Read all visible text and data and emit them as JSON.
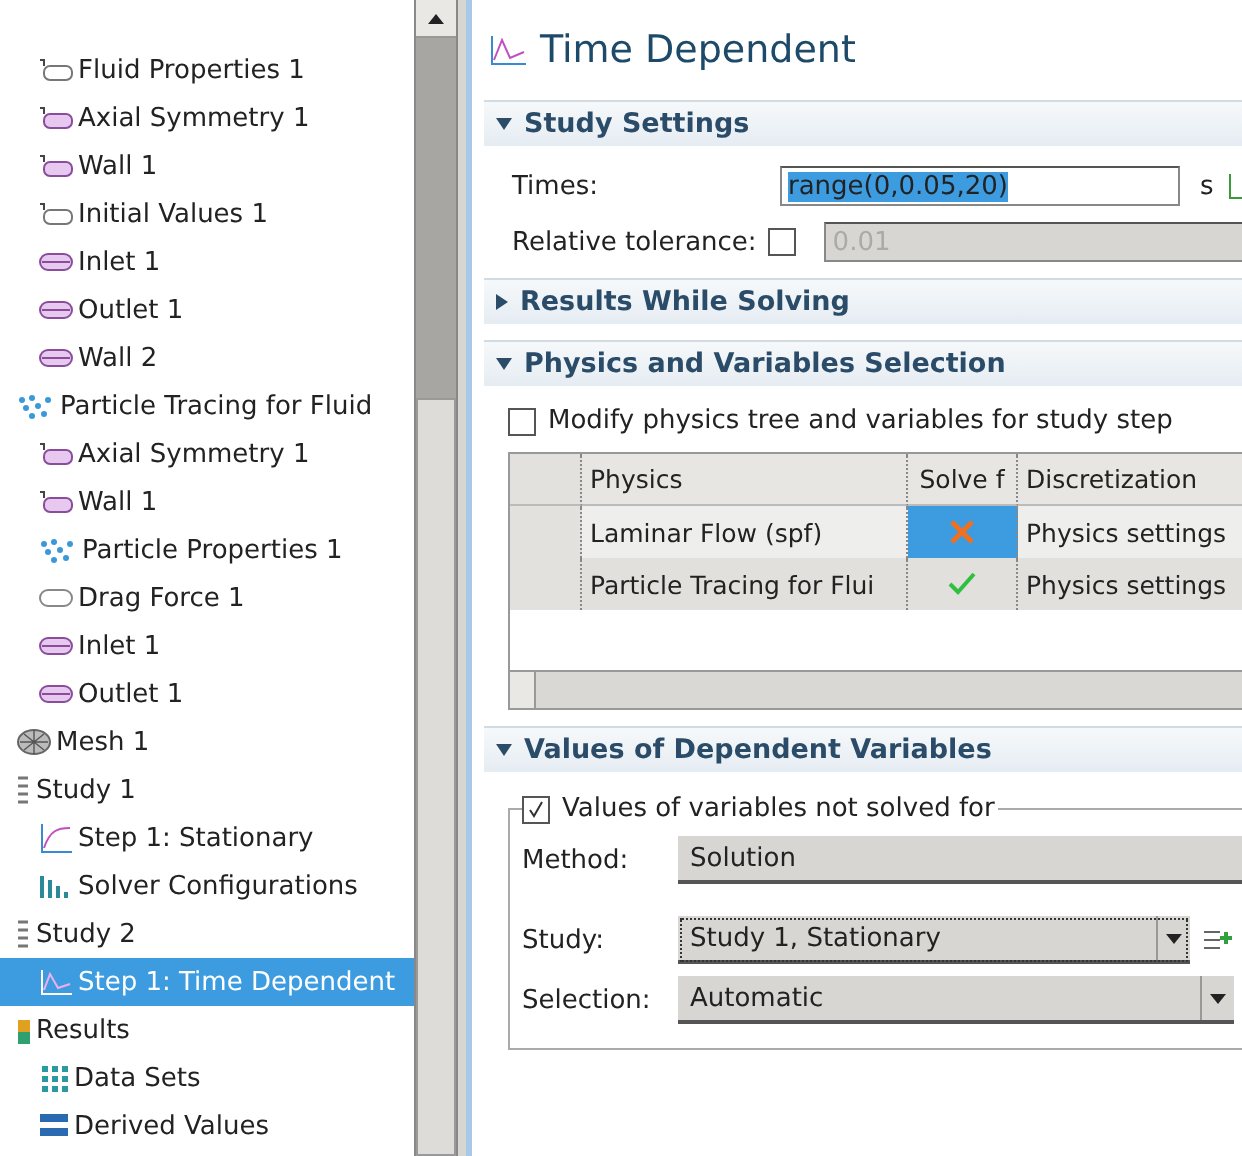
{
  "tree": [
    {
      "children": [
        {
          "children": [
            {
              "label": "Fluid Properties 1",
              "kind": "domain",
              "selected": false
            },
            {
              "label": "Axial Symmetry 1",
              "kind": "domain-feature",
              "selected": false
            },
            {
              "label": "Wall 1",
              "kind": "domain-feature",
              "selected": false
            },
            {
              "label": "Initial Values 1",
              "kind": "domain",
              "selected": false
            },
            {
              "label": "Inlet 1",
              "kind": "boundary",
              "selected": false
            },
            {
              "label": "Outlet 1",
              "kind": "boundary",
              "selected": false
            },
            {
              "label": "Wall 2",
              "kind": "boundary",
              "selected": false
            }
          ]
        },
        {
          "label": "Particle Tracing for Fluid",
          "kind": "particles",
          "selected": false,
          "children": [
            {
              "label": "Axial Symmetry 1",
              "kind": "domain-feature",
              "selected": false
            },
            {
              "label": "Wall 1",
              "kind": "domain-feature",
              "selected": false
            },
            {
              "label": "Particle Properties 1",
              "kind": "particles",
              "selected": false
            },
            {
              "label": "Drag Force 1",
              "kind": "pill",
              "selected": false
            },
            {
              "label": "Inlet 1",
              "kind": "boundary",
              "selected": false
            },
            {
              "label": "Outlet 1",
              "kind": "boundary",
              "selected": false
            }
          ]
        },
        {
          "label": "Mesh 1",
          "kind": "mesh",
          "selected": false
        }
      ]
    },
    {
      "label": "Study 1",
      "kind": "study",
      "selected": false,
      "children": [
        {
          "label": "Step 1: Stationary",
          "kind": "stationary",
          "selected": false
        },
        {
          "label": "Solver Configurations",
          "kind": "solver",
          "selected": false
        }
      ]
    },
    {
      "label": "Study 2",
      "kind": "study",
      "selected": false,
      "children": [
        {
          "label": "Step 1: Time Dependent",
          "kind": "time",
          "selected": true
        }
      ]
    },
    {
      "label": "Results",
      "kind": "results",
      "selected": false,
      "children": [
        {
          "label": "Data Sets",
          "kind": "datasets",
          "selected": false
        },
        {
          "label": "Derived Values",
          "kind": "derived",
          "selected": false
        }
      ]
    }
  ],
  "panel": {
    "title": "Time Dependent",
    "sections": [
      {
        "kind": "settings",
        "title": "Study Settings",
        "expanded": true,
        "times": {
          "label": "Times:",
          "value": "range(0,0.05,20)",
          "text_selected": true,
          "unit": "s"
        },
        "tolerance": {
          "label": "Relative tolerance:",
          "checked": false,
          "value": "0.01",
          "disabled": true
        }
      },
      {
        "kind": "results",
        "title": "Results While Solving",
        "expanded": false
      },
      {
        "kind": "physics",
        "title": "Physics and Variables Selection",
        "expanded": true,
        "checkbox": {
          "label": "Modify physics tree and variables for study step",
          "checked": false
        },
        "table": {
          "columns": [
            "Physics",
            "Solve f",
            "Discretization"
          ],
          "rows": [
            {
              "physics": "Laminar Flow (spf)",
              "solve": false,
              "discretization": "Physics settings",
              "selected": true
            },
            {
              "physics": "Particle Tracing for Flui",
              "solve": true,
              "discretization": "Physics settings",
              "selected": false
            }
          ]
        }
      },
      {
        "kind": "values",
        "title": "Values of Dependent Variables",
        "expanded": true,
        "group": {
          "label": "Values of variables not solved for",
          "checked": true,
          "fields": [
            {
              "label": "Method:",
              "value": "Solution",
              "focused": false
            },
            {
              "label": "Study:",
              "value": "Study 1, Stationary",
              "focused": true
            },
            {
              "label": "Selection:",
              "value": "Automatic",
              "focused": false
            }
          ]
        }
      }
    ]
  }
}
